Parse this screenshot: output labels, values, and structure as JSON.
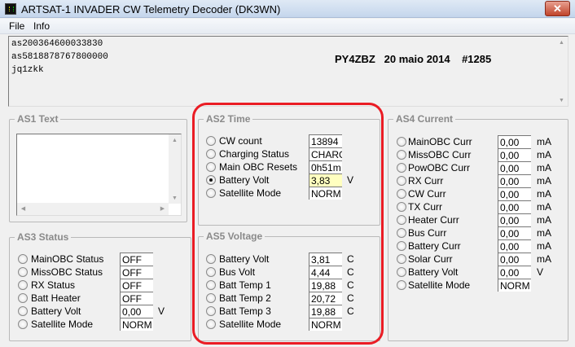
{
  "window": {
    "title": "ARTSAT-1 INVADER CW Telemetry Decoder (DK3WN)",
    "close": "✕"
  },
  "menu": [
    "File",
    "Info"
  ],
  "log": {
    "lines": [
      "as200364600033830",
      "as5818878767800000",
      "jq1zkk"
    ],
    "callsign": "PY4ZBZ   20 maio 2014    #1285"
  },
  "as1": {
    "title": "AS1 Text",
    "text": ""
  },
  "groups": {
    "as3": {
      "title": "AS3 Status",
      "rows": [
        {
          "label": "MainOBC Status",
          "value": "OFF",
          "unit": ""
        },
        {
          "label": "MissOBC Status",
          "value": "OFF",
          "unit": ""
        },
        {
          "label": "RX Status",
          "value": "OFF",
          "unit": ""
        },
        {
          "label": "Batt Heater",
          "value": "OFF",
          "unit": ""
        },
        {
          "label": "Battery Volt",
          "value": "0,00",
          "unit": "V"
        },
        {
          "label": "Satellite Mode",
          "value": "NORM",
          "unit": ""
        }
      ]
    },
    "as2": {
      "title": "AS2 Time",
      "rows": [
        {
          "label": "CW count",
          "value": "13894",
          "unit": ""
        },
        {
          "label": "Charging Status",
          "value": "CHARGE",
          "unit": ""
        },
        {
          "label": "Main OBC Resets",
          "value": "0h51m",
          "unit": ""
        },
        {
          "label": "Battery Volt",
          "value": "3,83",
          "unit": "V",
          "selected": true
        },
        {
          "label": "Satellite Mode",
          "value": "NORM",
          "unit": ""
        }
      ]
    },
    "as5": {
      "title": "AS5 Voltage",
      "rows": [
        {
          "label": "Battery Volt",
          "value": "3,81",
          "unit": "C"
        },
        {
          "label": "Bus Volt",
          "value": "4,44",
          "unit": "C"
        },
        {
          "label": "Batt Temp 1",
          "value": "19,88",
          "unit": "C"
        },
        {
          "label": "Batt Temp 2",
          "value": "20,72",
          "unit": "C"
        },
        {
          "label": "Batt Temp 3",
          "value": "19,88",
          "unit": "C"
        },
        {
          "label": "Satellite Mode",
          "value": "NORM",
          "unit": ""
        }
      ]
    },
    "as4": {
      "title": "AS4 Current",
      "rows": [
        {
          "label": "MainOBC Curr",
          "value": "0,00",
          "unit": "mA"
        },
        {
          "label": "MissOBC Curr",
          "value": "0,00",
          "unit": "mA"
        },
        {
          "label": "PowOBC Curr",
          "value": "0,00",
          "unit": "mA"
        },
        {
          "label": "RX Curr",
          "value": "0,00",
          "unit": "mA"
        },
        {
          "label": "CW Curr",
          "value": "0,00",
          "unit": "mA"
        },
        {
          "label": "TX Curr",
          "value": "0,00",
          "unit": "mA"
        },
        {
          "label": "Heater Curr",
          "value": "0,00",
          "unit": "mA"
        },
        {
          "label": "Bus Curr",
          "value": "0,00",
          "unit": "mA"
        },
        {
          "label": "Battery Curr",
          "value": "0,00",
          "unit": "mA"
        },
        {
          "label": "Solar Curr",
          "value": "0,00",
          "unit": "mA"
        },
        {
          "label": "Battery Volt",
          "value": "0,00",
          "unit": "V"
        },
        {
          "label": "Satellite Mode",
          "value": "NORM",
          "unit": ""
        }
      ]
    }
  },
  "colors": {
    "highlight": "#ea1c24",
    "selected_field": "#ffffc0"
  }
}
